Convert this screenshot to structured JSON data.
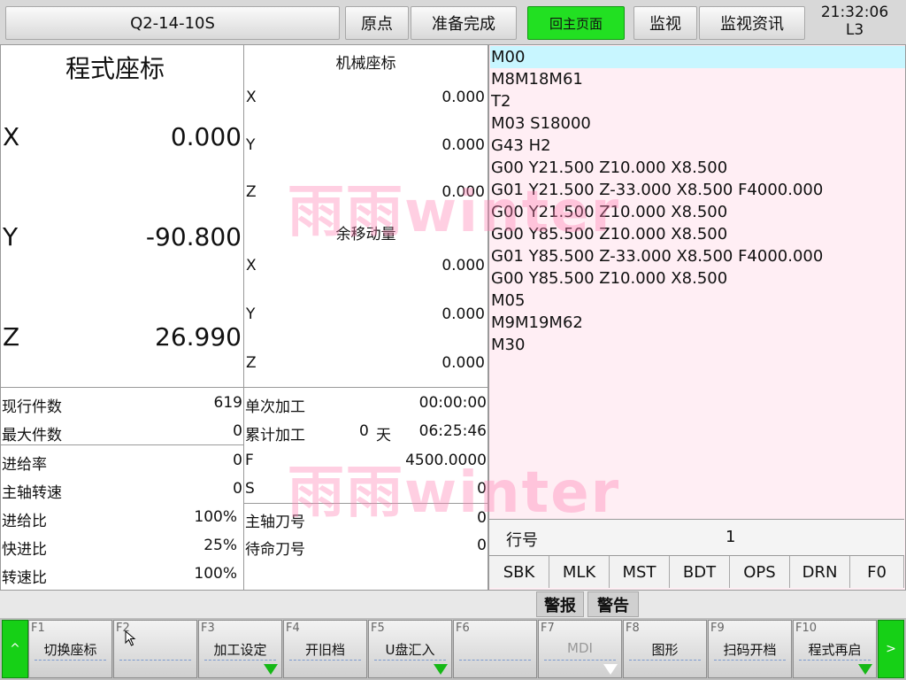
{
  "header": {
    "program_name": "Q2-14-10S",
    "home_label": "原点",
    "ready_label": "准备完成",
    "main_page_label": "回主页面",
    "monitor_label": "监视",
    "monitor_info_label": "监视资讯",
    "time": "21:32:06",
    "level": "L3"
  },
  "program_coords": {
    "title": "程式座标",
    "axes": [
      {
        "axis": "X",
        "value": "0.000"
      },
      {
        "axis": "Y",
        "value": "-90.800"
      },
      {
        "axis": "Z",
        "value": "26.990"
      }
    ]
  },
  "machine_coords": {
    "title": "机械座标",
    "axes": [
      {
        "axis": "X",
        "value": "0.000"
      },
      {
        "axis": "Y",
        "value": "0.000"
      },
      {
        "axis": "Z",
        "value": "0.000"
      }
    ]
  },
  "remaining": {
    "title": "余移动量",
    "axes": [
      {
        "axis": "X",
        "value": "0.000"
      },
      {
        "axis": "Y",
        "value": "0.000"
      },
      {
        "axis": "Z",
        "value": "0.000"
      }
    ]
  },
  "counts": {
    "current_parts_label": "现行件数",
    "current_parts": "619",
    "max_parts_label": "最大件数",
    "max_parts": "0",
    "single_label": "单次加工",
    "single_time": "00:00:00",
    "total_label": "累计加工",
    "total_days": "0",
    "days_unit": "天",
    "total_time": "06:25:46"
  },
  "feeds": {
    "feed_rate_label": "进给率",
    "feed_rate": "0",
    "spindle_speed_label": "主轴转速",
    "spindle_speed": "0",
    "feed_ratio_label": "进给比",
    "feed_ratio": "100%",
    "rapid_ratio_label": "快进比",
    "rapid_ratio": "25%",
    "speed_ratio_label": "转速比",
    "speed_ratio": "100%",
    "f_label": "F",
    "f_value": "4500.0000",
    "s_label": "S",
    "s_value": "0",
    "spindle_tool_label": "主轴刀号",
    "spindle_tool": "0",
    "standby_tool_label": "待命刀号",
    "standby_tool": "0"
  },
  "program": {
    "lines": [
      "M00",
      "M8M18M61",
      "T2",
      "M03 S18000",
      "G43 H2",
      "G00 Y21.500 Z10.000 X8.500",
      "G01 Y21.500 Z-33.000 X8.500 F4000.000",
      "G00 Y21.500 Z10.000 X8.500",
      "G00 Y85.500 Z10.000 X8.500",
      "G01 Y85.500 Z-33.000 X8.500 F4000.000",
      "G00 Y85.500 Z10.000 X8.500",
      "M05",
      "M9M19M62",
      "M30"
    ],
    "line_no_label": "行号",
    "line_no": "1"
  },
  "modes": [
    "SBK",
    "MLK",
    "MST",
    "BDT",
    "OPS",
    "DRN",
    "F0"
  ],
  "alarm": {
    "alarm_label": "警报",
    "warning_label": "警告"
  },
  "watermark": "雨雨winter",
  "softkeys": {
    "left_arrow": "^",
    "right_arrow": ">",
    "keys": [
      {
        "num": "F1",
        "label": "切换座标"
      },
      {
        "num": "F2",
        "label": ""
      },
      {
        "num": "F3",
        "label": "加工设定"
      },
      {
        "num": "F4",
        "label": "开旧档"
      },
      {
        "num": "F5",
        "label": "U盘汇入"
      },
      {
        "num": "F6",
        "label": ""
      },
      {
        "num": "F7",
        "label": "MDI"
      },
      {
        "num": "F8",
        "label": "图形"
      },
      {
        "num": "F9",
        "label": "扫码开档"
      },
      {
        "num": "F10",
        "label": "程式再启"
      }
    ]
  },
  "colors": {
    "accent_green": "#22e022",
    "current_line": "#c8f6ff",
    "program_bg": "#ffeef4"
  }
}
